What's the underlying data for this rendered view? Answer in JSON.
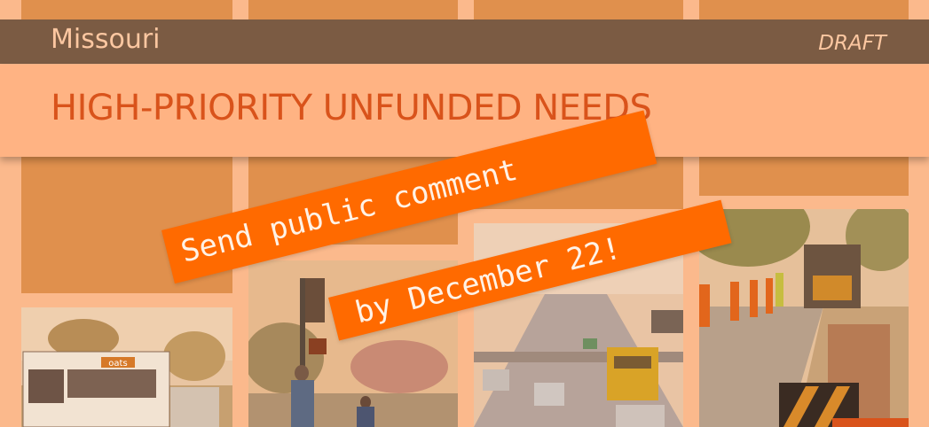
{
  "header": {
    "state": "Missouri",
    "status": "DRAFT",
    "title": "HIGH-PRIORITY UNFUNDED NEEDS"
  },
  "banner": {
    "line1": "Send public comment",
    "line2": "by December 22!"
  },
  "photos": [
    {
      "id": "bus",
      "label": "oats"
    },
    {
      "id": "pedestrians",
      "label": ""
    },
    {
      "id": "highway",
      "label": ""
    },
    {
      "id": "workzone",
      "label": ""
    }
  ],
  "colors": {
    "background": "#fbb98c",
    "tile": "#e0904d",
    "header_bar": "#7b5b43",
    "title_band": "#ffb383",
    "title_text": "#d9531b",
    "banner": "#ff6a00"
  }
}
